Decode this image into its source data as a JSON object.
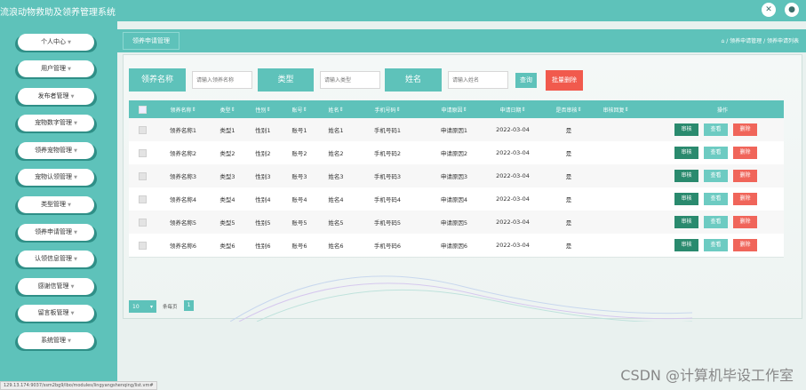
{
  "app": {
    "title": "流浪动物救助及领养管理系统",
    "icons": [
      "expand-icon",
      "user-icon"
    ]
  },
  "sidebar": {
    "items": [
      {
        "label": "个人中心"
      },
      {
        "label": "用户管理"
      },
      {
        "label": "发布者管理"
      },
      {
        "label": "宠物数字管理"
      },
      {
        "label": "领养宠物管理"
      },
      {
        "label": "宠物认领管理"
      },
      {
        "label": "类型管理"
      },
      {
        "label": "领养申请管理"
      },
      {
        "label": "认领信息管理"
      },
      {
        "label": "感谢信管理"
      },
      {
        "label": "留言板管理"
      },
      {
        "label": "系统管理"
      }
    ]
  },
  "header": {
    "section_label": "领养申请管理",
    "breadcrumb": "⌂ / 领养申请管理 / 领养申请列表"
  },
  "search": {
    "name_label": "领养名称",
    "name_placeholder": "请输入领养名称",
    "type_label": "类型",
    "type_placeholder": "请输入类型",
    "person_label": "姓名",
    "person_placeholder": "请输入姓名",
    "search_button": "查询",
    "batch_delete_button": "批量删除"
  },
  "table": {
    "headers": [
      "领养名称",
      "类型",
      "性别",
      "账号",
      "姓名",
      "手机号码",
      "申请原因",
      "申请日期",
      "是否审核",
      "审核回复",
      "操作"
    ],
    "rows": [
      {
        "cells": [
          "领养名称1",
          "类型1",
          "性别1",
          "账号1",
          "姓名1",
          "手机号码1",
          "申请原因1",
          "2022-03-04",
          "是",
          ""
        ]
      },
      {
        "cells": [
          "领养名称2",
          "类型2",
          "性别2",
          "账号2",
          "姓名2",
          "手机号码2",
          "申请原因2",
          "2022-03-04",
          "是",
          ""
        ]
      },
      {
        "cells": [
          "领养名称3",
          "类型3",
          "性别3",
          "账号3",
          "姓名3",
          "手机号码3",
          "申请原因3",
          "2022-03-04",
          "是",
          ""
        ]
      },
      {
        "cells": [
          "领养名称4",
          "类型4",
          "性别4",
          "账号4",
          "姓名4",
          "手机号码4",
          "申请原因4",
          "2022-03-04",
          "是",
          ""
        ]
      },
      {
        "cells": [
          "领养名称5",
          "类型5",
          "性别5",
          "账号5",
          "姓名5",
          "手机号码5",
          "申请原因5",
          "2022-03-04",
          "是",
          ""
        ]
      },
      {
        "cells": [
          "领养名称6",
          "类型6",
          "性别6",
          "账号6",
          "姓名6",
          "手机号码6",
          "申请原因6",
          "2022-03-04",
          "是",
          ""
        ]
      }
    ],
    "actions": {
      "review": "审核",
      "view": "查看",
      "delete": "删除"
    }
  },
  "pager": {
    "page_size": "10",
    "per_page_label": "条每页",
    "current_page": "1"
  },
  "watermark": "CSDN @计算机毕设工作室",
  "status_url": "129.13.174:9037/ssm2bg9/lbo/modules/lingyangshenqing/list.vm#",
  "colors": {
    "primary": "#5ec2ba",
    "review": "#2a8a6e",
    "view": "#6dcbc2",
    "delete": "#f0655a",
    "batch_delete": "#f15a4d"
  }
}
